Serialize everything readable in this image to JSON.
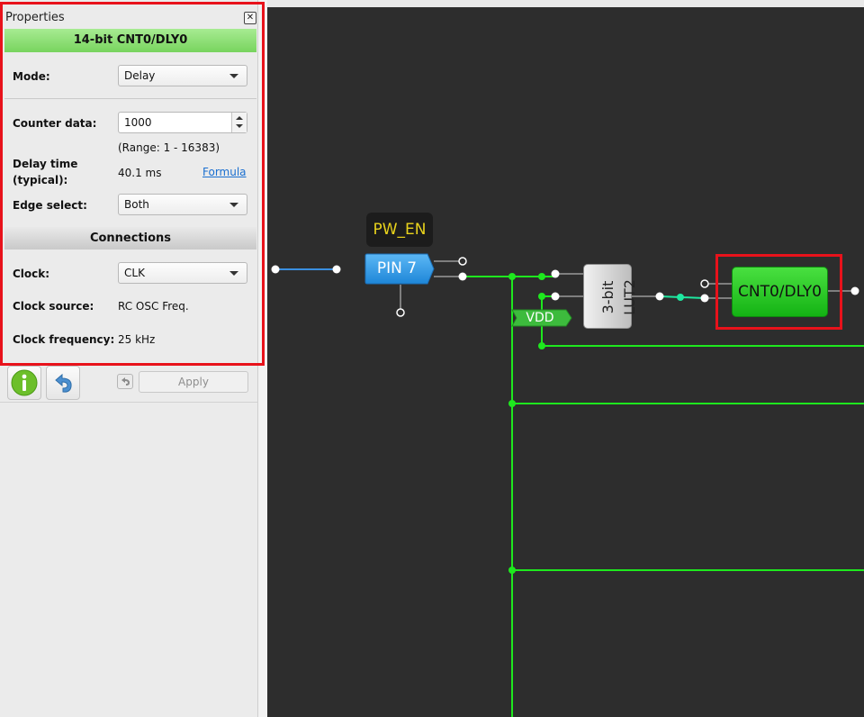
{
  "properties_panel": {
    "title": "Properties",
    "close_icon": "close-icon",
    "block_name": "14-bit CNT0/DLY0",
    "mode": {
      "label": "Mode:",
      "value": "Delay"
    },
    "counter_data": {
      "label": "Counter data:",
      "value": "1000",
      "range": "(Range:  1 - 16383)"
    },
    "delay_time": {
      "label_line1": "Delay time",
      "label_line2": "(typical):",
      "value": "40.1 ms",
      "formula_link": "Formula"
    },
    "edge_select": {
      "label": "Edge select:",
      "value": "Both"
    },
    "connections_header": "Connections",
    "clock": {
      "label": "Clock:",
      "value": "CLK"
    },
    "clock_source": {
      "label": "Clock source:",
      "value": "RC OSC Freq."
    },
    "clock_frequency": {
      "label": "Clock frequency:",
      "value": "25 kHz"
    }
  },
  "toolbar": {
    "info_icon": "info-icon",
    "undo_icon": "undo-icon",
    "small_undo_icon": "small-undo-icon",
    "apply_label": "Apply"
  },
  "canvas": {
    "pin_label": "PW_EN",
    "pin_block": "PIN 7",
    "lut_block": "3-bit LUT2",
    "vdd_label": "VDD",
    "cnt_block": "CNT0/DLY0"
  },
  "colors": {
    "canvas_bg": "#2d2d2d",
    "wire_green": "#1ee81e",
    "wire_blue": "#3a8fe0",
    "highlight_red": "#e8121b",
    "header_green": "#8ede74",
    "pin_label_yellow": "#e8d21c"
  }
}
